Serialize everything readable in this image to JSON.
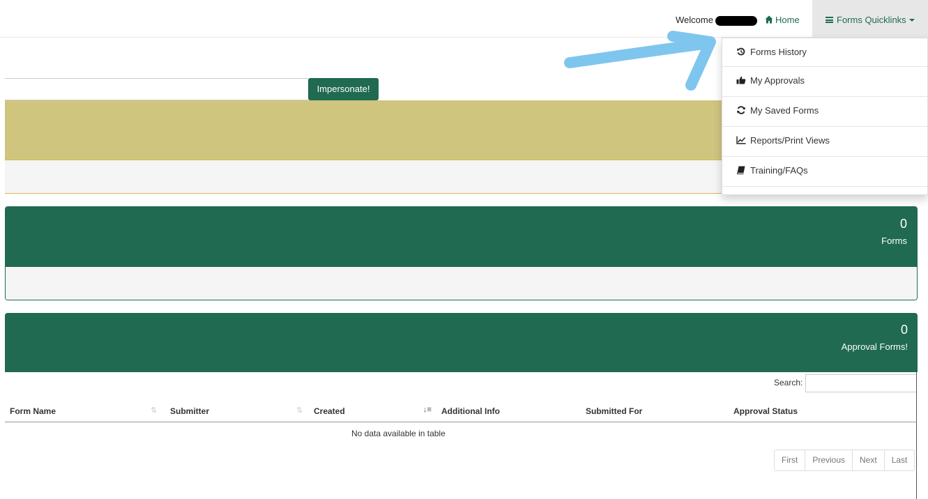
{
  "navbar": {
    "welcome": "Welcome",
    "home_label": "Home",
    "quicklinks_label": "Forms Quicklinks",
    "icons": {
      "home": "home-icon",
      "menu": "bars-icon",
      "caret": "caret-down-icon"
    }
  },
  "impersonate": {
    "button_label": "Impersonate!"
  },
  "colors": {
    "brand_green": "#1f6a50",
    "gold": "#cfc57f",
    "panel_body": "#f5f5f5",
    "annotation_arrow": "#7fc6ef"
  },
  "forms_panel": {
    "count": "0",
    "label": "Forms"
  },
  "approval_panel": {
    "count": "0",
    "label": "Approval Forms!"
  },
  "table": {
    "search_label": "Search:",
    "search_value": "",
    "columns": [
      "Form Name",
      "Submitter",
      "Created",
      "Additional Info",
      "Submitted For",
      "Approval Status"
    ],
    "empty_message": "No data available in table",
    "pagination": [
      "First",
      "Previous",
      "Next",
      "Last"
    ]
  },
  "dropdown": {
    "items": [
      {
        "label": "Forms History",
        "icon": "history-icon"
      },
      {
        "label": "My Approvals",
        "icon": "thumbs-up-icon"
      },
      {
        "label": "My Saved Forms",
        "icon": "refresh-icon"
      },
      {
        "label": "Reports/Print Views",
        "icon": "line-chart-icon"
      },
      {
        "label": "Training/FAQs",
        "icon": "book-icon"
      }
    ]
  }
}
